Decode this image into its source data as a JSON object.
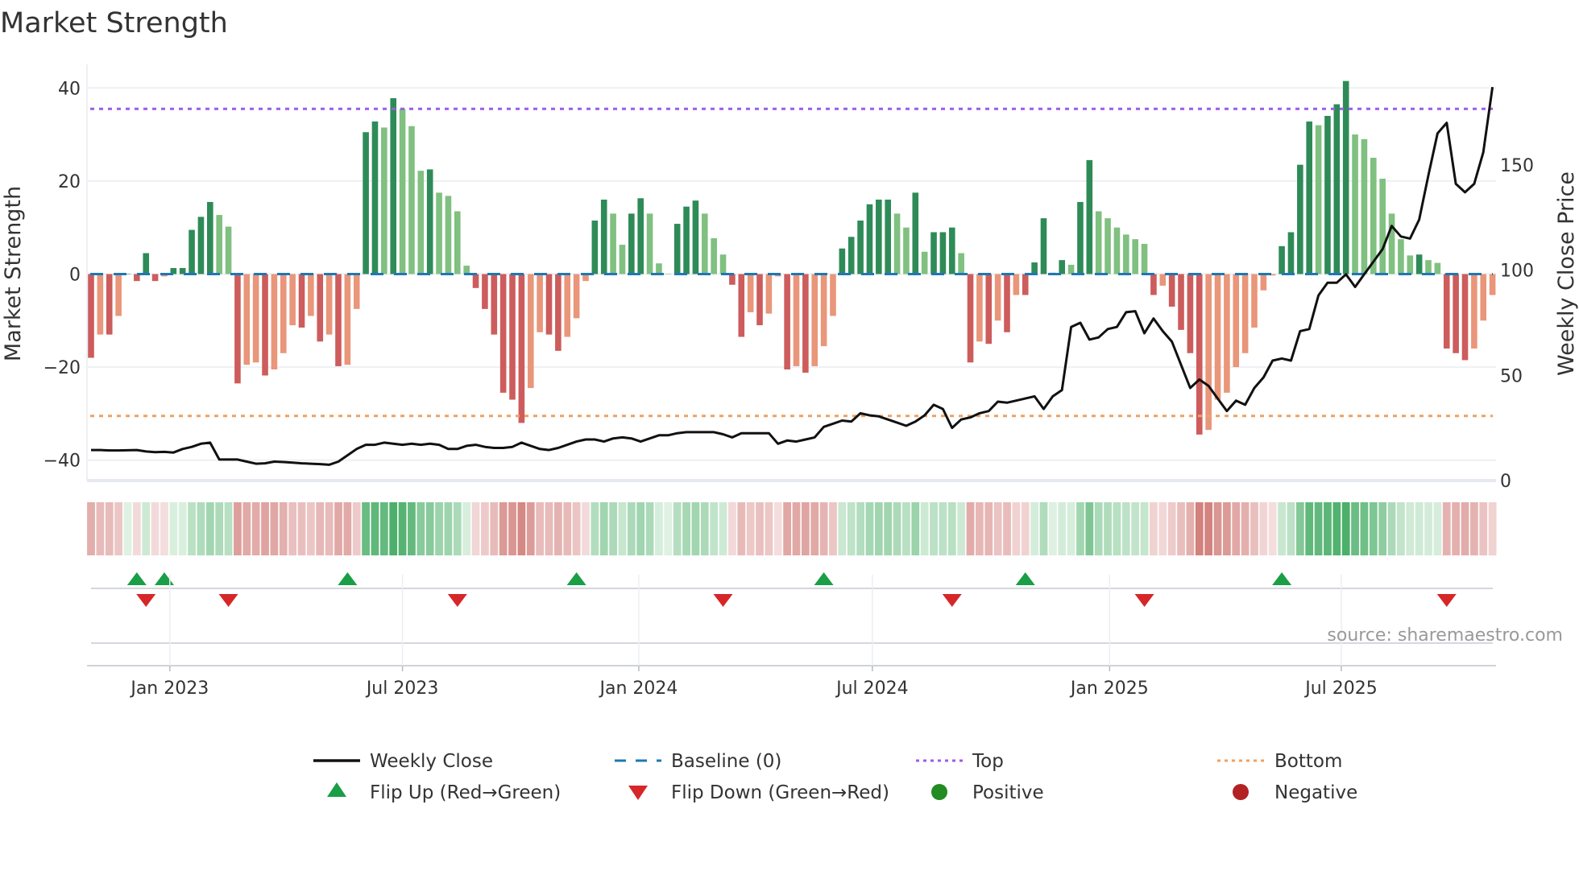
{
  "chart_data": {
    "type": "bar",
    "title": "Market Strength",
    "ylabel": "Market Strength",
    "y2label": "Weekly Close Price",
    "ylim": [
      -44,
      44
    ],
    "y2lim": [
      0,
      190
    ],
    "yticks": [
      "40",
      "20",
      "0",
      "−20",
      "−40"
    ],
    "ytick_values": [
      40,
      20,
      0,
      -20,
      -40
    ],
    "y2ticks": [
      "150",
      "100",
      "50",
      "0"
    ],
    "y2tick_values": [
      150,
      100,
      50,
      0
    ],
    "xticks": [
      {
        "label": "Jan 2023",
        "week": 8.6
      },
      {
        "label": "Jul 2023",
        "week": 34.0
      },
      {
        "label": "Jan 2024",
        "week": 59.8
      },
      {
        "label": "Jul 2024",
        "week": 85.3
      },
      {
        "label": "Jan 2025",
        "week": 111.2
      },
      {
        "label": "Jul 2025",
        "week": 136.5
      }
    ],
    "top_level": 35.5,
    "bottom_level": -30.5,
    "baseline": 0,
    "strength": [
      -18,
      -13,
      -13,
      -9,
      0,
      -1.5,
      4.5,
      -1.5,
      -0.5,
      1.3,
      1.3,
      9.5,
      12.3,
      15.5,
      12.7,
      10.2,
      -23.5,
      -19.5,
      -19,
      -21.8,
      -20.5,
      -17,
      -11,
      -11.5,
      -9,
      -14.5,
      -13,
      -19.8,
      -19.5,
      -7.5,
      30.5,
      32.8,
      31.5,
      37.8,
      35.5,
      31.8,
      22.2,
      22.5,
      17.5,
      16.8,
      13.5,
      1.8,
      -3,
      -7.5,
      -13,
      -25.5,
      -27,
      -32,
      -24.5,
      -12.5,
      -13,
      -16.5,
      -13.5,
      -9.5,
      -1.5,
      11.5,
      16,
      13,
      6.3,
      13,
      16.3,
      13,
      2.3,
      0,
      10.8,
      14.5,
      15.8,
      13,
      7.7,
      4.2,
      -2.3,
      -13.5,
      -8.2,
      -11,
      -8.5,
      -0.5,
      -20.5,
      -19.8,
      -21.2,
      -19.8,
      -15.5,
      -9,
      5.5,
      8,
      11.5,
      15,
      16,
      16,
      13,
      10,
      17.5,
      4.8,
      9,
      9,
      10,
      4.5,
      -19,
      -14.5,
      -15,
      -10,
      -12.5,
      -4.5,
      -4.5,
      2.5,
      12,
      0.3,
      3,
      2,
      15.5,
      24.5,
      13.5,
      12,
      10,
      8.5,
      7.5,
      6.5,
      -4.5,
      -2.5,
      -7,
      -12,
      -17,
      -34.5,
      -33.5,
      -27,
      -25.5,
      -20,
      -17,
      -11.5,
      -3.5,
      -0.3,
      6,
      9,
      23.5,
      32.8,
      32,
      34,
      36.5,
      41.5,
      30,
      29,
      25,
      20.5,
      13,
      7.5,
      4,
      4.2,
      3,
      2.4,
      -16,
      -17,
      -18.5,
      -16,
      -10,
      -4.5
    ],
    "weekly_close": [
      14.5,
      14.5,
      14.3,
      14.3,
      14.4,
      14.5,
      13.8,
      13.5,
      13.6,
      13.3,
      15,
      16,
      17.5,
      18,
      10,
      10,
      10,
      9,
      8,
      8.2,
      9,
      8.8,
      8.5,
      8.2,
      8,
      7.8,
      7.5,
      9,
      12,
      15,
      17,
      17,
      18,
      17.5,
      17,
      17.5,
      17,
      17.5,
      17,
      15,
      15,
      16.5,
      17,
      16,
      15.5,
      15.5,
      16,
      18,
      16.5,
      15,
      14.5,
      15.5,
      17,
      18.5,
      19.5,
      19.5,
      18.5,
      20,
      20.5,
      20,
      18.5,
      20,
      21.5,
      21.5,
      22.5,
      23,
      23,
      23,
      23,
      22,
      20.5,
      22.5,
      22.5,
      22.5,
      22.5,
      17.5,
      19,
      18.5,
      19.5,
      20.5,
      25.5,
      27,
      28.5,
      28,
      32,
      31,
      30.5,
      29,
      27.5,
      26,
      28,
      31,
      36,
      34,
      25,
      29,
      30,
      32,
      33,
      37.5,
      37,
      38,
      39,
      40,
      34,
      40,
      43,
      73,
      75,
      67,
      68,
      72,
      73,
      80,
      80.5,
      70,
      77,
      71,
      66,
      55,
      44,
      48,
      45,
      39,
      33,
      38,
      36,
      44,
      49,
      57,
      58,
      57,
      71,
      72,
      88,
      94,
      94,
      98,
      92,
      98,
      104,
      110,
      121,
      116,
      115,
      124,
      145,
      165,
      170,
      141,
      137,
      141,
      156,
      187
    ],
    "flip_up_weeks": [
      5,
      8,
      28,
      53,
      80,
      102,
      130
    ],
    "flip_down_weeks": [
      6,
      15,
      40,
      69,
      94,
      115,
      148
    ],
    "legend": {
      "weekly_close": "Weekly Close",
      "baseline": "Baseline (0)",
      "top": "Top",
      "bottom": "Bottom",
      "flip_up": "Flip Up (Red→Green)",
      "flip_down": "Flip Down (Green→Red)",
      "positive": "Positive",
      "negative": "Negative"
    },
    "legend_placement": "bottom",
    "source": "source: sharemaestro.com",
    "colors": {
      "pos_rising": "#2e8b57",
      "pos_falling": "#80c080",
      "neg_falling": "#cd5c5c",
      "neg_rising": "#e9967a",
      "baseline": "#1f77b4",
      "top": "#9b5de5",
      "bottom": "#f0a060",
      "close": "#111111",
      "flip_up": "#1a9e46",
      "flip_down": "#d62728",
      "positive": "#228b22",
      "negative": "#b22222"
    }
  }
}
